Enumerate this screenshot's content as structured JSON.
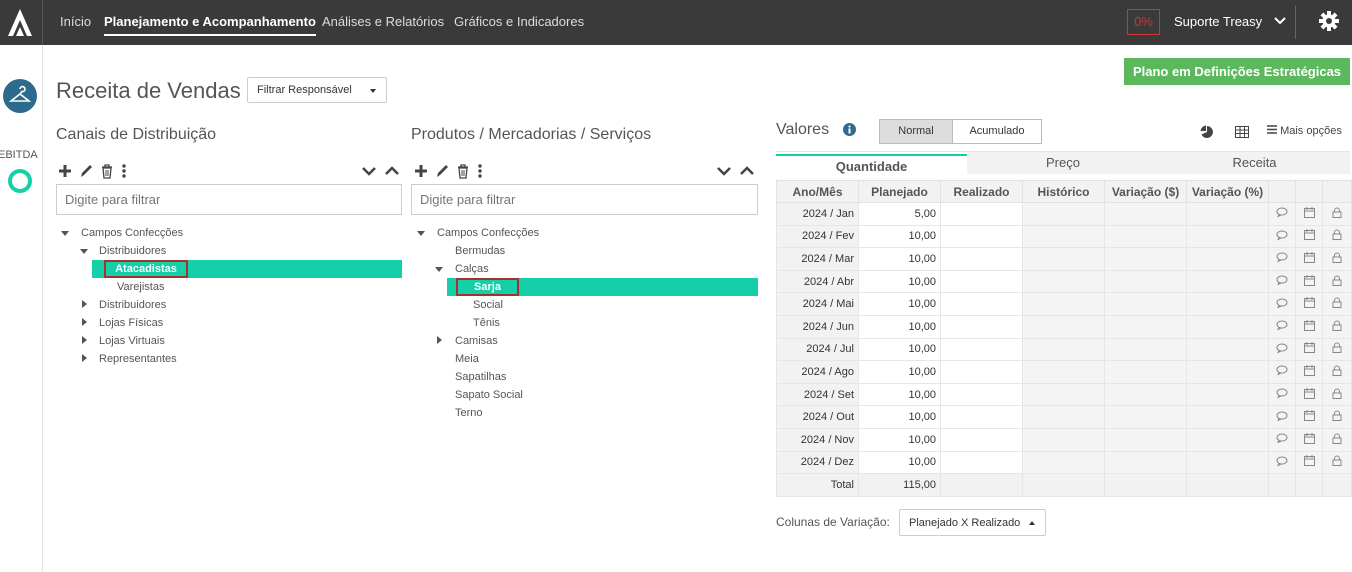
{
  "nav": {
    "items": [
      "Início",
      "Planejamento e Acompanhamento",
      "Análises e Relatórios",
      "Gráficos e Indicadores"
    ],
    "progress_badge": "0%",
    "user": "Suporte Treasy"
  },
  "rail": {
    "label": "EBITDA"
  },
  "page": {
    "title": "Receita de Vendas",
    "filter_responsible": "Filtrar Responsável",
    "plan_button": "Plano em Definições Estratégicas"
  },
  "channels": {
    "title": "Canais de Distribuição",
    "filter_placeholder": "Digite para filtrar",
    "tree": {
      "root": "Campos Confecções",
      "group": "Distribuidores",
      "selected": "Atacadistas",
      "sibling": "Varejistas",
      "others": [
        "Distribuidores",
        "Lojas Físicas",
        "Lojas Virtuais",
        "Representantes"
      ]
    }
  },
  "products": {
    "title": "Produtos / Mercadorias / Serviços",
    "filter_placeholder": "Digite para filtrar",
    "tree": {
      "root": "Campos Confecções",
      "bermudas": "Bermudas",
      "group": "Calças",
      "selected": "Sarja",
      "children": [
        "Social",
        "Tênis"
      ],
      "camisas": "Camisas",
      "others": [
        "Meia",
        "Sapatilhas",
        "Sapato Social",
        "Terno"
      ]
    }
  },
  "values": {
    "title": "Valores",
    "mode_normal": "Normal",
    "mode_acumulado": "Acumulado",
    "more_options": "Mais opções",
    "tabs": [
      "Quantidade",
      "Preço",
      "Receita"
    ],
    "columns": [
      "Ano/Mês",
      "Planejado",
      "Realizado",
      "Histórico",
      "Variação ($)",
      "Variação (%)"
    ],
    "rows": [
      {
        "month": "2024 / Jan",
        "planned": "5,00"
      },
      {
        "month": "2024 / Fev",
        "planned": "10,00"
      },
      {
        "month": "2024 / Mar",
        "planned": "10,00"
      },
      {
        "month": "2024 / Abr",
        "planned": "10,00"
      },
      {
        "month": "2024 / Mai",
        "planned": "10,00"
      },
      {
        "month": "2024 / Jun",
        "planned": "10,00"
      },
      {
        "month": "2024 / Jul",
        "planned": "10,00"
      },
      {
        "month": "2024 / Ago",
        "planned": "10,00"
      },
      {
        "month": "2024 / Set",
        "planned": "10,00"
      },
      {
        "month": "2024 / Out",
        "planned": "10,00"
      },
      {
        "month": "2024 / Nov",
        "planned": "10,00"
      },
      {
        "month": "2024 / Dez",
        "planned": "10,00"
      }
    ],
    "total_label": "Total",
    "total_planned": "115,00",
    "variation_label": "Colunas de Variação:",
    "variation_value": "Planejado X Realizado"
  },
  "colors": {
    "accent": "#14cfa8",
    "topbar": "#3a3a3a",
    "green": "#5cb85c",
    "badge": "#d0342c"
  }
}
